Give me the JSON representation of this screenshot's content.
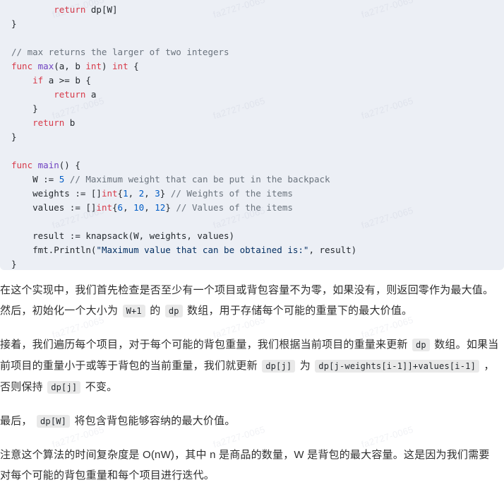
{
  "watermark": {
    "text": "fa2727-0065",
    "color": "#7882a0"
  },
  "code_block": {
    "language": "go",
    "theme_background": "#eceff5",
    "colors": {
      "keyword": "#d73a49",
      "function": "#6f42c1",
      "type": "#d73a49",
      "number": "#005cc5",
      "string": "#032f62",
      "comment": "#6a737d",
      "plain": "#24292e"
    },
    "lines": [
      "        return dp[W]",
      "}",
      "",
      "// max returns the larger of two integers",
      "func max(a, b int) int {",
      "    if a >= b {",
      "        return a",
      "    }",
      "    return b",
      "}",
      "",
      "func main() {",
      "    W := 5 // Maximum weight that can be put in the backpack",
      "    weights := []int{1, 2, 3} // Weights of the items",
      "    values := []int{6, 10, 12} // Values of the items",
      "",
      "    result := knapsack(W, weights, values)",
      "    fmt.Println(\"Maximum value that can be obtained is:\", result)",
      "}"
    ]
  },
  "prose": {
    "paragraph_1": {
      "part_1": "在这个实现中，我们首先检查是否至少有一个项目或背包容量不为零，如果没有，则返回零作为最大值。然后，初始化一个大小为",
      "chip_1": "W+1",
      "part_2": "的",
      "chip_2": "dp",
      "part_3": "数组，用于存储每个可能的重量下的最大价值。"
    },
    "paragraph_2": {
      "part_1": "接着，我们遍历每个项目，对于每个可能的背包重量，我们根据当前项目的重量来更新",
      "chip_1": "dp",
      "part_2": "数组。如果当前项目的重量小于或等于背包的当前重量，我们就更新",
      "chip_2": "dp[j]",
      "part_3": "为",
      "chip_3": "dp[j-weights[i-1]]+values[i-1]",
      "part_4": "，否则保持",
      "chip_4": "dp[j]",
      "part_5": "不变。"
    },
    "paragraph_3": {
      "part_1": "最后，",
      "chip_1": "dp[W]",
      "part_2": "将包含背包能够容纳的最大价值。"
    },
    "paragraph_4": {
      "text": "注意这个算法的时间复杂度是 O(nW)，其中 n 是商品的数量，W 是背包的最大容量。这是因为我们需要对每个可能的背包重量和每个项目进行迭代。"
    }
  }
}
